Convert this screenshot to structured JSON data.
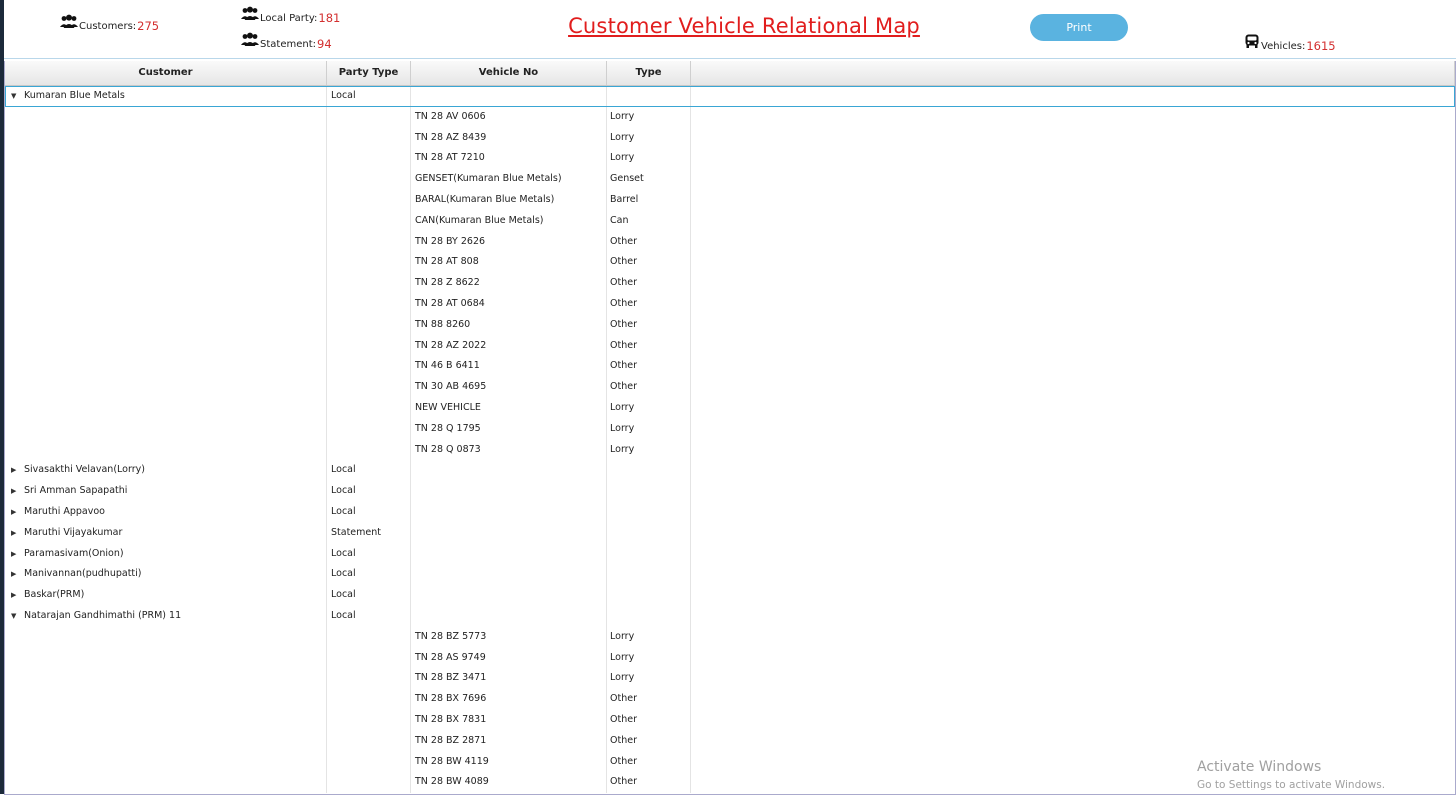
{
  "header": {
    "customers_label": "Customers:",
    "customers_count": "275",
    "local_party_label": "Local Party:",
    "local_party_count": "181",
    "statement_label": "Statement:",
    "statement_count": "94",
    "title": "Customer Vehicle Relational Map",
    "print_label": "Print",
    "vehicles_label": "Vehicles:",
    "vehicles_count": "1615",
    "icons": {
      "group": "users-group-icon",
      "vehicle": "bus-icon"
    },
    "colors": {
      "accent": "#e11d1d",
      "count": "#d32f2f",
      "button": "#5ab3e0"
    }
  },
  "table": {
    "columns": [
      "Customer",
      "Party Type",
      "Vehicle No",
      "Type"
    ],
    "rows": [
      {
        "arrow": "▼",
        "customer": "Kumaran Blue Metals",
        "party": "Local",
        "vehicle": "",
        "type": ""
      },
      {
        "arrow": "",
        "customer": "",
        "party": "",
        "vehicle": "TN 28 AV 0606",
        "type": "Lorry"
      },
      {
        "arrow": "",
        "customer": "",
        "party": "",
        "vehicle": "TN 28 AZ 8439",
        "type": "Lorry"
      },
      {
        "arrow": "",
        "customer": "",
        "party": "",
        "vehicle": "TN 28 AT 7210",
        "type": "Lorry"
      },
      {
        "arrow": "",
        "customer": "",
        "party": "",
        "vehicle": "GENSET(Kumaran Blue Metals)",
        "type": "Genset"
      },
      {
        "arrow": "",
        "customer": "",
        "party": "",
        "vehicle": "BARAL(Kumaran Blue Metals)",
        "type": "Barrel"
      },
      {
        "arrow": "",
        "customer": "",
        "party": "",
        "vehicle": "CAN(Kumaran Blue Metals)",
        "type": "Can"
      },
      {
        "arrow": "",
        "customer": "",
        "party": "",
        "vehicle": "TN 28 BY 2626",
        "type": "Other"
      },
      {
        "arrow": "",
        "customer": "",
        "party": "",
        "vehicle": "TN 28 AT 808",
        "type": "Other"
      },
      {
        "arrow": "",
        "customer": "",
        "party": "",
        "vehicle": "TN 28 Z 8622",
        "type": "Other"
      },
      {
        "arrow": "",
        "customer": "",
        "party": "",
        "vehicle": "TN 28 AT 0684",
        "type": "Other"
      },
      {
        "arrow": "",
        "customer": "",
        "party": "",
        "vehicle": "TN 88 8260",
        "type": "Other"
      },
      {
        "arrow": "",
        "customer": "",
        "party": "",
        "vehicle": "TN 28 AZ 2022",
        "type": "Other"
      },
      {
        "arrow": "",
        "customer": "",
        "party": "",
        "vehicle": "TN 46 B 6411",
        "type": "Other"
      },
      {
        "arrow": "",
        "customer": "",
        "party": "",
        "vehicle": "TN 30 AB 4695",
        "type": "Other"
      },
      {
        "arrow": "",
        "customer": "",
        "party": "",
        "vehicle": "NEW VEHICLE",
        "type": "Lorry"
      },
      {
        "arrow": "",
        "customer": "",
        "party": "",
        "vehicle": "TN 28 Q 1795",
        "type": "Lorry"
      },
      {
        "arrow": "",
        "customer": "",
        "party": "",
        "vehicle": "TN 28 Q 0873",
        "type": "Lorry"
      },
      {
        "arrow": "▶",
        "customer": "Sivasakthi Velavan(Lorry)",
        "party": "Local",
        "vehicle": "",
        "type": ""
      },
      {
        "arrow": "▶",
        "customer": "Sri Amman Sapapathi",
        "party": "Local",
        "vehicle": "",
        "type": ""
      },
      {
        "arrow": "▶",
        "customer": "Maruthi Appavoo",
        "party": "Local",
        "vehicle": "",
        "type": ""
      },
      {
        "arrow": "▶",
        "customer": "Maruthi Vijayakumar",
        "party": "Statement",
        "vehicle": "",
        "type": ""
      },
      {
        "arrow": "▶",
        "customer": "Paramasivam(Onion)",
        "party": "Local",
        "vehicle": "",
        "type": ""
      },
      {
        "arrow": "▶",
        "customer": "Manivannan(pudhupatti)",
        "party": "Local",
        "vehicle": "",
        "type": ""
      },
      {
        "arrow": "▶",
        "customer": "Baskar(PRM)",
        "party": "Local",
        "vehicle": "",
        "type": ""
      },
      {
        "arrow": "▼",
        "customer": "Natarajan Gandhimathi (PRM) 11",
        "party": "Local",
        "vehicle": "",
        "type": ""
      },
      {
        "arrow": "",
        "customer": "",
        "party": "",
        "vehicle": "TN 28 BZ 5773",
        "type": "Lorry"
      },
      {
        "arrow": "",
        "customer": "",
        "party": "",
        "vehicle": "TN 28 AS 9749",
        "type": "Lorry"
      },
      {
        "arrow": "",
        "customer": "",
        "party": "",
        "vehicle": "TN 28 BZ 3471",
        "type": "Lorry"
      },
      {
        "arrow": "",
        "customer": "",
        "party": "",
        "vehicle": "TN 28 BX 7696",
        "type": "Other"
      },
      {
        "arrow": "",
        "customer": "",
        "party": "",
        "vehicle": "TN 28 BX 7831",
        "type": "Other"
      },
      {
        "arrow": "",
        "customer": "",
        "party": "",
        "vehicle": "TN 28 BZ 2871",
        "type": "Other"
      },
      {
        "arrow": "",
        "customer": "",
        "party": "",
        "vehicle": "TN 28 BW 4119",
        "type": "Other"
      },
      {
        "arrow": "",
        "customer": "",
        "party": "",
        "vehicle": "TN 28 BW 4089",
        "type": "Other"
      }
    ]
  },
  "watermark": {
    "line1": "Activate Windows",
    "line2": "Go to Settings to activate Windows."
  }
}
